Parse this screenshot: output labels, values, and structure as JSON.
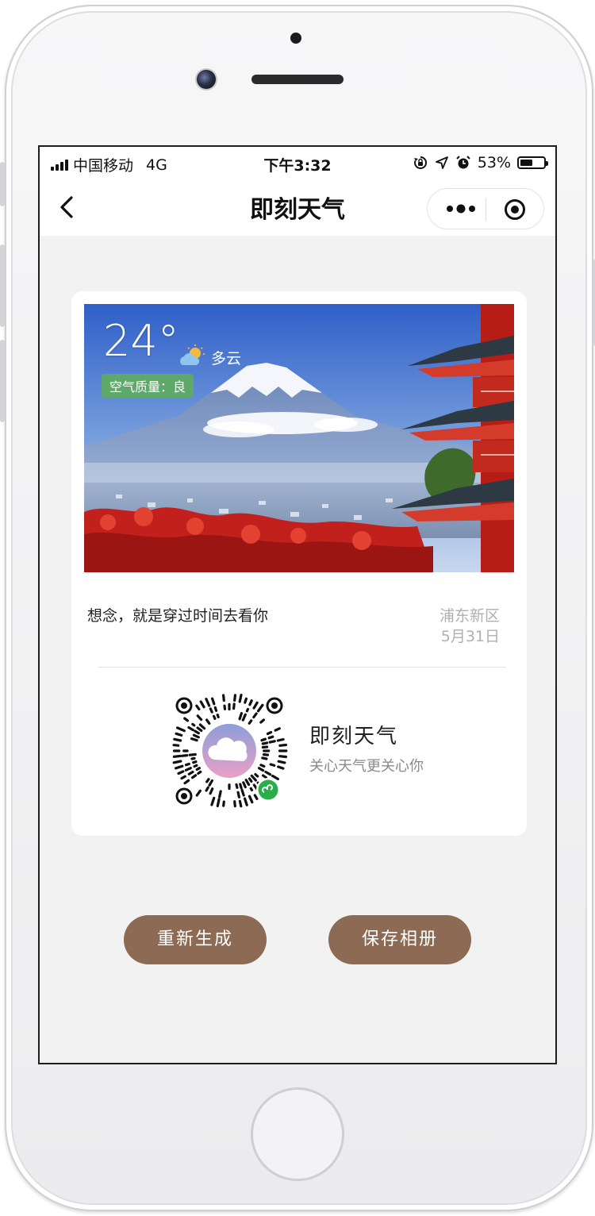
{
  "status_bar": {
    "carrier": "中国移动",
    "network": "4G",
    "time": "下午3:32",
    "battery": "53%",
    "battery_level": 0.53
  },
  "navbar": {
    "title": "即刻天气"
  },
  "weather": {
    "temperature": "24°",
    "condition": "多云",
    "air_quality": "空气质量：良",
    "icon": "partly-cloudy-icon"
  },
  "card": {
    "slogan": "想念，就是穿过时间去看你",
    "location": "浦东新区",
    "date": "5月31日",
    "app_name": "即刻天气",
    "app_tagline": "关心天气更关心你"
  },
  "actions": {
    "regenerate_label": "重新生成",
    "save_label": "保存相册"
  },
  "colors": {
    "button": "#8d6a53",
    "aqi_badge": "#5ea86a"
  }
}
